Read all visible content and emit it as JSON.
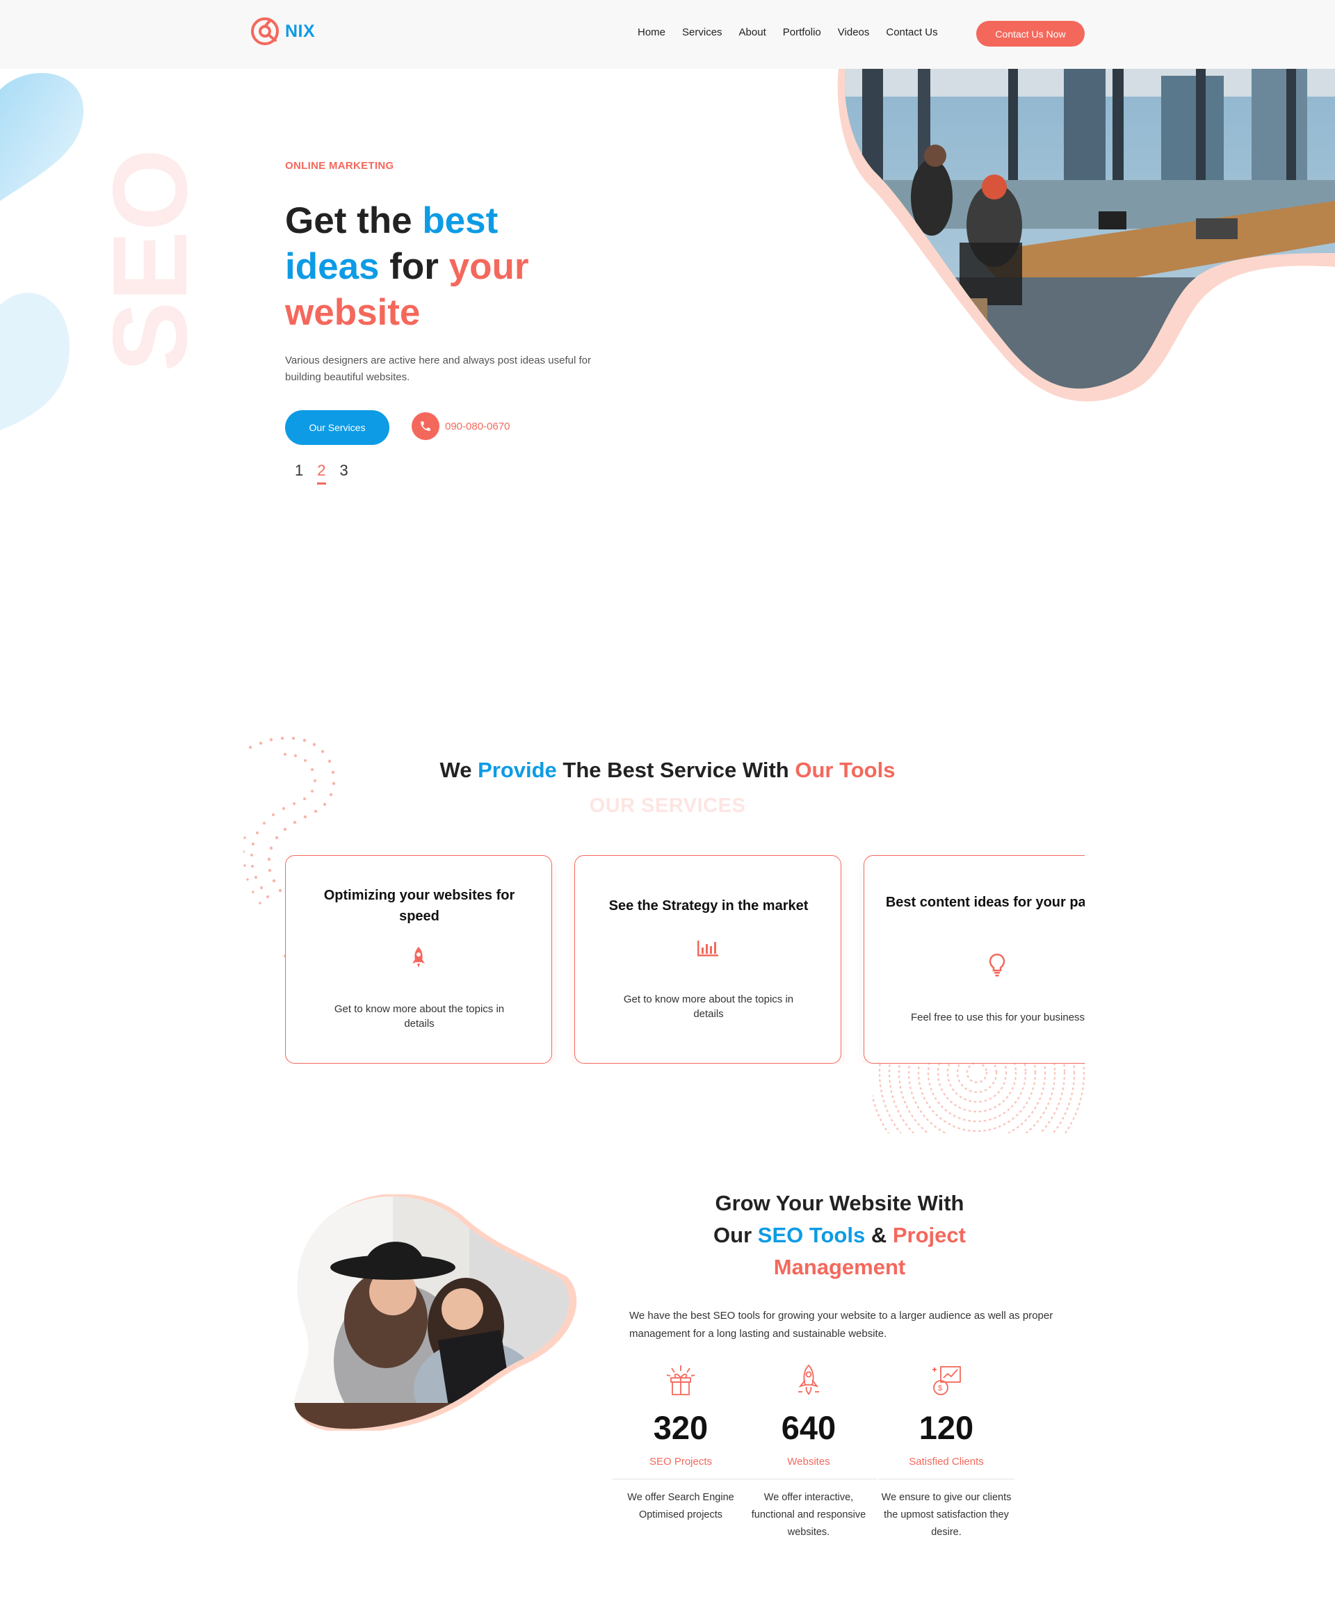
{
  "header": {
    "logo_text": "NIX",
    "nav": [
      "Home",
      "Services",
      "About",
      "Portfolio",
      "Videos",
      "Contact Us"
    ],
    "cta_label": "Contact Us Now"
  },
  "hero": {
    "background_word": "SEO",
    "eyebrow": "ONLINE MARKETING",
    "title_parts": [
      "Get the ",
      "best",
      "ideas",
      " for ",
      "your",
      "website"
    ],
    "description": "Various designers are active here and always post ideas useful for building beautiful websites.",
    "primary_button": "Our Services",
    "phone": "090-080-0670",
    "pager": [
      "1",
      "2",
      "3"
    ],
    "pager_active": "2"
  },
  "services": {
    "title_parts": [
      "We ",
      "Provide",
      " The Best Service With ",
      "Our Tools"
    ],
    "subtitle": "OUR SERVICES",
    "cards": [
      {
        "title": "Optimizing your websites for speed",
        "icon": "rocket-icon",
        "description": "Get to know more about the topics in details"
      },
      {
        "title": "See the Strategy in the market",
        "icon": "bar-chart-icon",
        "description": "Get to know more about the topics in details"
      },
      {
        "title": "Best content ideas for your pages",
        "icon": "lightbulb-icon",
        "description": "Feel free to use this for your business"
      }
    ]
  },
  "grow": {
    "title_parts": [
      "Grow Your Website With",
      "Our ",
      "SEO Tools",
      " & ",
      "Project",
      "Management"
    ],
    "description": "We have the best SEO tools for growing your website to a larger audience as well as proper management for a long lasting and sustainable website.",
    "stats": [
      {
        "value": "320",
        "label": "SEO Projects",
        "icon": "gift-box-icon",
        "description": "We offer Search Engine Optimised projects"
      },
      {
        "value": "640",
        "label": "Websites",
        "icon": "rocket-launch-icon",
        "description": "We offer interactive, functional and responsive websites."
      },
      {
        "value": "120",
        "label": "Satisfied Clients",
        "icon": "money-growth-icon",
        "description": "We ensure to give our clients the upmost satisfaction they desire."
      }
    ]
  },
  "colors": {
    "accent_blue": "#0d9be5",
    "accent_coral": "#f4685c",
    "faint_coral": "#fde5e2"
  }
}
